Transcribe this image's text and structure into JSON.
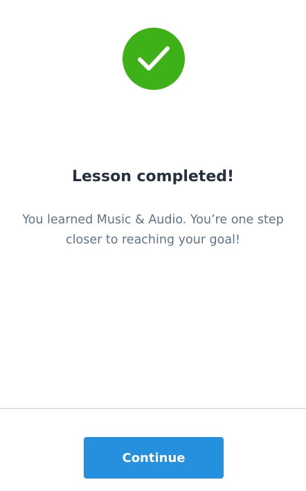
{
  "completion": {
    "icon": "checkmark-icon",
    "icon_color": "#3fb118",
    "title": "Lesson completed!",
    "message": "You learned Music & Audio. You’re one step closer to reaching your goal!"
  },
  "footer": {
    "continue_label": "Continue",
    "button_color": "#2590dd"
  }
}
